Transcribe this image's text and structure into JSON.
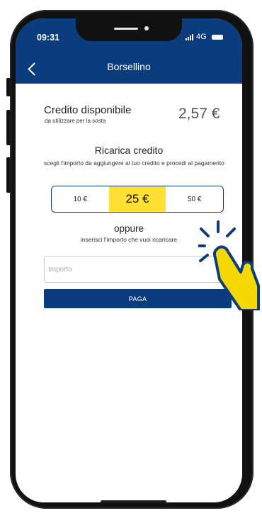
{
  "status_bar": {
    "time": "09:31",
    "network": "4G"
  },
  "header": {
    "title": "Borsellino"
  },
  "credit": {
    "label": "Credito disponibile",
    "sublabel": "da utilizzare per la sosta",
    "amount": "2,57 €"
  },
  "recharge": {
    "title": "Ricarica credito",
    "description": "scegli l'importo da aggiungere al tuo credito e procedi al pagamento",
    "options": [
      "10 €",
      "25 €",
      "50 €"
    ],
    "selected_index": 1
  },
  "custom": {
    "title": "oppure",
    "description": "inserisci l'importo che vuoi ricaricare",
    "placeholder": "Importo",
    "currency": "€"
  },
  "pay_button": {
    "label": "PAGA"
  },
  "colors": {
    "primary": "#0b3d7e",
    "highlight": "#ffe033"
  },
  "icons": [
    "back-chevron-icon",
    "signal-icon",
    "battery-icon",
    "tap-hand-icon"
  ]
}
